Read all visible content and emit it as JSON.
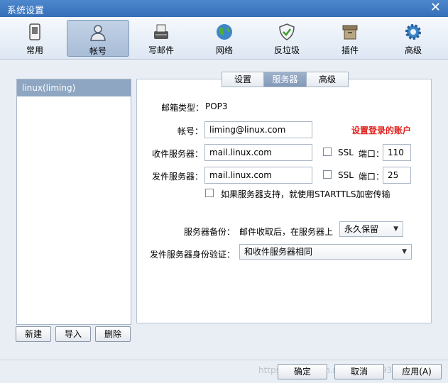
{
  "window": {
    "title": "系统设置",
    "close": "✕"
  },
  "toolbar": {
    "items": [
      {
        "label": "常用",
        "icon": "phone-icon"
      },
      {
        "label": "帐号",
        "icon": "user-icon",
        "active": true
      },
      {
        "label": "写邮件",
        "icon": "writer-icon"
      },
      {
        "label": "网络",
        "icon": "globe-icon"
      },
      {
        "label": "反垃圾",
        "icon": "shield-icon"
      },
      {
        "label": "插件",
        "icon": "box-icon"
      },
      {
        "label": "高级",
        "icon": "gear-icon"
      }
    ]
  },
  "accounts": {
    "items": [
      "linux(liming)"
    ]
  },
  "account_buttons": {
    "new": "新建",
    "import": "导入",
    "delete": "删除"
  },
  "tabs": {
    "items": [
      "设置",
      "服务器",
      "高级"
    ],
    "active": "服务器"
  },
  "server": {
    "type_label": "邮箱类型：",
    "type_value": "POP3",
    "account_label": "帐号：",
    "account_value": "liming@linux.com",
    "note": "设置登录的账户",
    "incoming_label": "收件服务器：",
    "incoming_value": "mail.linux.com",
    "incoming_ssl": "SSL",
    "incoming_port_label": "端口：",
    "incoming_port": "110",
    "outgoing_label": "发件服务器：",
    "outgoing_value": "mail.linux.com",
    "outgoing_ssl": "SSL",
    "outgoing_port_label": "端口：",
    "outgoing_port": "25",
    "starttls_label": "如果服务器支持，就使用STARTTLS加密传输",
    "backup_label": "服务器备份：",
    "backup_desc": "邮件收取后，在服务器上",
    "backup_value": "永久保留",
    "auth_label": "发件服务器身份验证：",
    "auth_value": "和收件服务器相同"
  },
  "footer": {
    "ok": "确定",
    "cancel": "取消",
    "apply": "应用(A)",
    "watermark": "https://blog.csdn.net/liming0931"
  },
  "colors": {
    "titlebar": "#4278c2",
    "active_tab": "#8ea6c2",
    "note_red": "#e0211c"
  }
}
